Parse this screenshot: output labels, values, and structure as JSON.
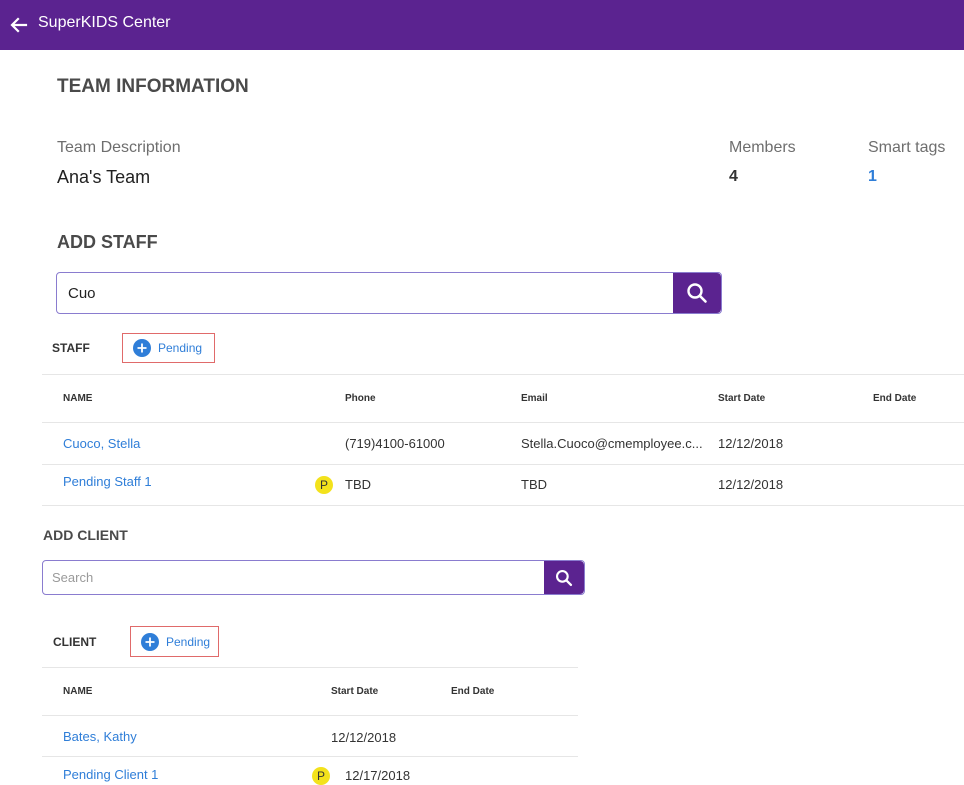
{
  "header": {
    "title": "SuperKIDS Center"
  },
  "team_info": {
    "heading": "TEAM INFORMATION",
    "description_label": "Team Description",
    "description_value": "Ana's Team",
    "members_label": "Members",
    "members_value": "4",
    "smart_tags_label": "Smart tags",
    "smart_tags_value": "1"
  },
  "add_staff": {
    "heading": "ADD STAFF",
    "search_value": "Cuo"
  },
  "staff": {
    "label": "STAFF",
    "pending_label": "Pending",
    "columns": [
      "NAME",
      "Phone",
      "Email",
      "Start Date",
      "End Date"
    ],
    "rows": [
      {
        "name": "Cuoco, Stella",
        "phone": "(719)4100-61000",
        "email": "Stella.Cuoco@cmemployee.c...",
        "start": "12/12/2018",
        "end": ""
      },
      {
        "name": "Pending Staff 1",
        "badge": "P",
        "phone": "TBD",
        "email": "TBD",
        "start": "12/12/2018",
        "end": ""
      }
    ]
  },
  "add_client": {
    "heading": "ADD CLIENT",
    "search_placeholder": "Search"
  },
  "client": {
    "label": "CLIENT",
    "pending_label": "Pending",
    "columns": [
      "NAME",
      "Start Date",
      "End Date"
    ],
    "rows": [
      {
        "name": "Bates, Kathy",
        "start": "12/12/2018",
        "end": ""
      },
      {
        "name": "Pending Client 1",
        "badge": "P",
        "start": "12/17/2018",
        "end": ""
      }
    ]
  },
  "colors": {
    "header_bg": "#5b2390",
    "link": "#2f7ed8",
    "badge": "#f3e21c",
    "highlight_border": "#e06a6a"
  }
}
